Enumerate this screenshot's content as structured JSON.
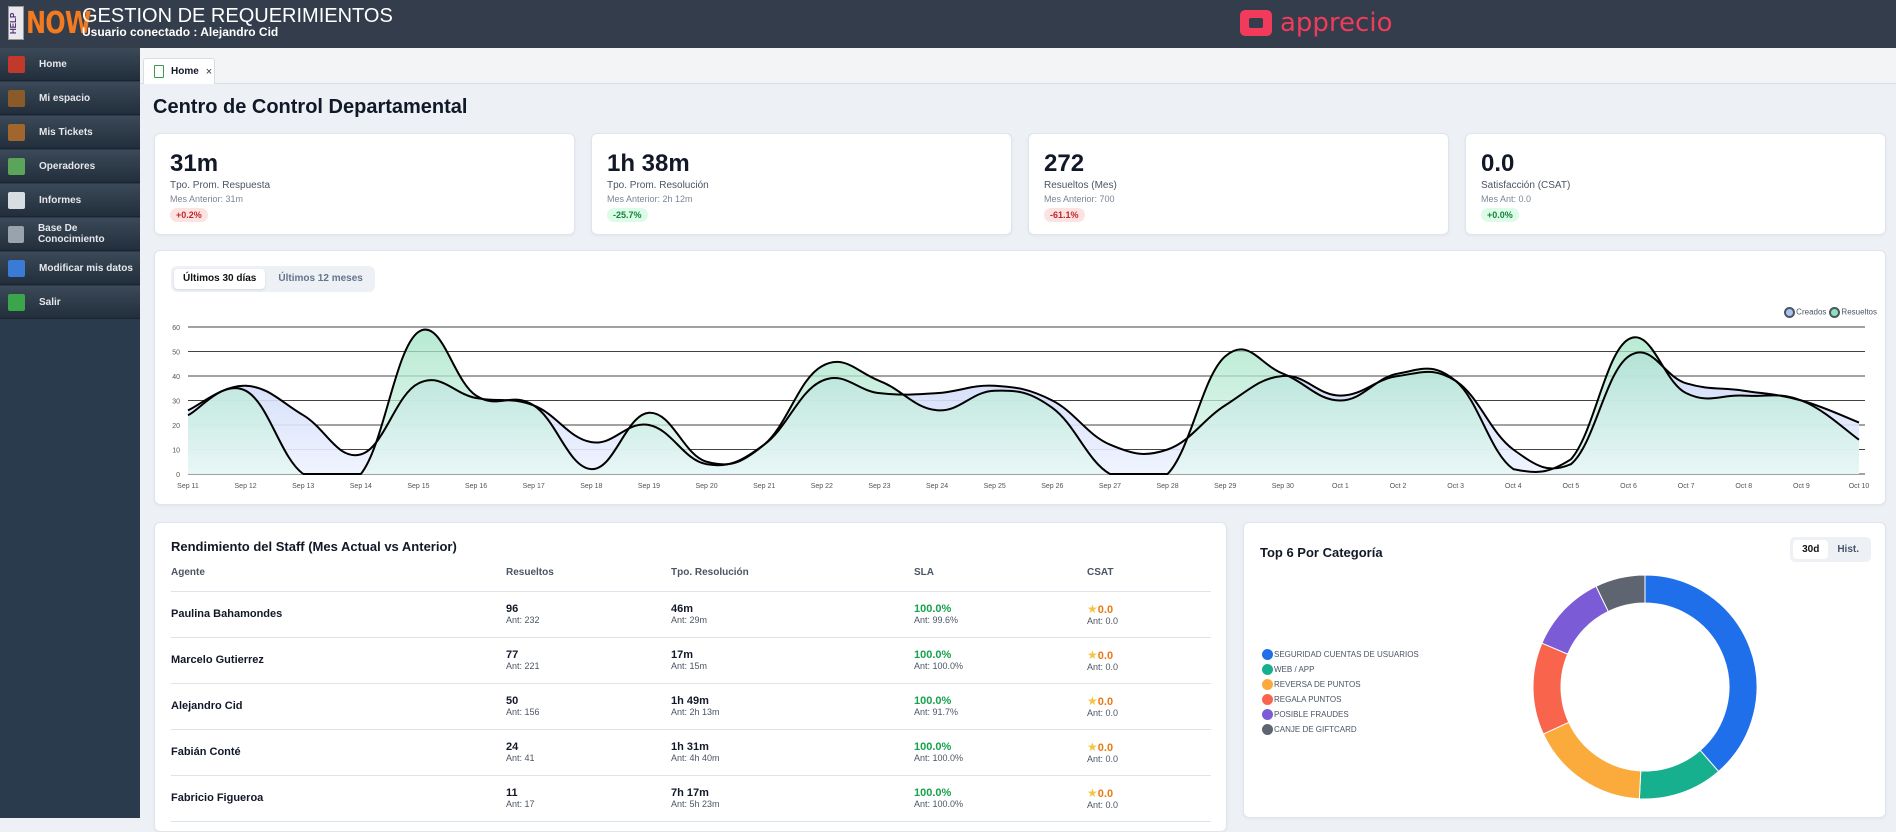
{
  "header": {
    "logo_text": "HELP NOW",
    "title": "GESTION DE REQUERIMIENTOS",
    "user": "Usuario conectado : Alejandro Cid",
    "brand": "apprecio",
    "brand_color": "#f23a5a"
  },
  "sidebar": {
    "items": [
      {
        "label": "Home",
        "icon": "home-icon",
        "color": "#c0392b"
      },
      {
        "label": "Mi espacio",
        "icon": "briefcase-icon",
        "color": "#8b5a2b"
      },
      {
        "label": "Mis Tickets",
        "icon": "book-icon",
        "color": "#a0662e"
      },
      {
        "label": "Operadores",
        "icon": "checklist-icon",
        "color": "#5aa55a"
      },
      {
        "label": "Informes",
        "icon": "documents-icon",
        "color": "#d8dde3"
      },
      {
        "label": "Base De Conocimiento",
        "icon": "open-book-icon",
        "color": "#9aa3ad"
      },
      {
        "label": "Modificar mis datos",
        "icon": "pen-icon",
        "color": "#3a7bd5"
      },
      {
        "label": "Salir",
        "icon": "exit-icon",
        "color": "#3aa54a"
      }
    ]
  },
  "tabs": [
    {
      "label": "Home",
      "close": "×"
    }
  ],
  "page_title": "Centro de Control Departamental",
  "kpis": [
    {
      "value": "31m",
      "label": "Tpo. Prom. Respuesta",
      "prev": "Mes Anterior: 31m",
      "delta": "+0.2%",
      "status": "bad"
    },
    {
      "value": "1h 38m",
      "label": "Tpo. Prom. Resolución",
      "prev": "Mes Anterior: 2h 12m",
      "delta": "-25.7%",
      "status": "good"
    },
    {
      "value": "272",
      "label": "Resueltos (Mes)",
      "prev": "Mes Anterior: 700",
      "delta": "-61.1%",
      "status": "bad"
    },
    {
      "value": "0.0",
      "label": "Satisfacción (CSAT)",
      "prev": "Mes Ant: 0.0",
      "delta": "+0.0%",
      "status": "good"
    }
  ],
  "trend": {
    "range_tabs": [
      "Últimos 30 días",
      "Últimos 12 meses"
    ],
    "active": 0
  },
  "chart_data": {
    "type": "area",
    "grid": true,
    "legend": "top-right",
    "ylim": [
      0,
      60
    ],
    "yticks": [
      0,
      10,
      20,
      30,
      40,
      50,
      60
    ],
    "categories": [
      "Sep 11",
      "Sep 12",
      "Sep 13",
      "Sep 14",
      "Sep 15",
      "Sep 16",
      "Sep 17",
      "Sep 18",
      "Sep 19",
      "Sep 20",
      "Sep 21",
      "Sep 22",
      "Sep 23",
      "Sep 24",
      "Sep 25",
      "Sep 26",
      "Sep 27",
      "Sep 28",
      "Sep 29",
      "Sep 30",
      "Oct 1",
      "Oct 2",
      "Oct 3",
      "Oct 4",
      "Oct 5",
      "Oct 6",
      "Oct 7",
      "Oct 8",
      "Oct 9",
      "Oct 10"
    ],
    "series": [
      {
        "name": "Creados",
        "color": "#a8c4f0",
        "values": [
          26,
          36,
          24,
          8,
          37,
          31,
          28,
          13,
          20,
          4,
          12,
          38,
          33,
          33,
          36,
          30,
          12,
          10,
          28,
          40,
          32,
          40,
          38,
          10,
          4,
          48,
          37,
          34,
          30,
          21
        ]
      },
      {
        "name": "Resueltos",
        "color": "#8ee0b8",
        "values": [
          24,
          34,
          0,
          0,
          58,
          32,
          28,
          2,
          25,
          5,
          12,
          44,
          38,
          26,
          34,
          27,
          0,
          0,
          48,
          41,
          30,
          41,
          38,
          2,
          6,
          55,
          33,
          32,
          30,
          14
        ]
      }
    ]
  },
  "staff": {
    "title": "Rendimiento del Staff (Mes Actual vs Anterior)",
    "columns": [
      "Agente",
      "Resueltos",
      "Tpo. Resolución",
      "SLA",
      "CSAT"
    ],
    "rows": [
      {
        "agent": "Paulina Bahamondes",
        "resueltos": "96",
        "resueltos_ant": "Ant: 232",
        "tiempo": "46m",
        "tiempo_ant": "Ant: 29m",
        "sla": "100.0%",
        "sla_ant": "Ant: 99.6%",
        "csat": "0.0",
        "csat_ant": "Ant: 0.0"
      },
      {
        "agent": "Marcelo Gutierrez",
        "resueltos": "77",
        "resueltos_ant": "Ant: 221",
        "tiempo": "17m",
        "tiempo_ant": "Ant: 15m",
        "sla": "100.0%",
        "sla_ant": "Ant: 100.0%",
        "csat": "0.0",
        "csat_ant": "Ant: 0.0"
      },
      {
        "agent": "Alejandro Cid",
        "resueltos": "50",
        "resueltos_ant": "Ant: 156",
        "tiempo": "1h 49m",
        "tiempo_ant": "Ant: 2h 13m",
        "sla": "100.0%",
        "sla_ant": "Ant: 91.7%",
        "csat": "0.0",
        "csat_ant": "Ant: 0.0"
      },
      {
        "agent": "Fabián Conté",
        "resueltos": "24",
        "resueltos_ant": "Ant: 41",
        "tiempo": "1h 31m",
        "tiempo_ant": "Ant: 4h 40m",
        "sla": "100.0%",
        "sla_ant": "Ant: 100.0%",
        "csat": "0.0",
        "csat_ant": "Ant: 0.0"
      },
      {
        "agent": "Fabricio Figueroa",
        "resueltos": "11",
        "resueltos_ant": "Ant: 17",
        "tiempo": "7h 17m",
        "tiempo_ant": "Ant: 5h 23m",
        "sla": "100.0%",
        "sla_ant": "Ant: 100.0%",
        "csat": "0.0",
        "csat_ant": "Ant: 0.0"
      }
    ]
  },
  "categories": {
    "title": "Top 6 Por Categoría",
    "toggle": [
      "30d",
      "Hist."
    ],
    "active": 0,
    "donut": {
      "type": "pie",
      "unit": "percent",
      "items": [
        {
          "label": "SEGURIDAD CUENTAS DE USUARIOS",
          "value": 38.6,
          "color": "#1f6feb"
        },
        {
          "label": "WEB / APP",
          "value": 12.2,
          "color": "#17b08f"
        },
        {
          "label": "REVERSA DE PUNTOS",
          "value": 17.3,
          "color": "#fbab3c"
        },
        {
          "label": "REGALA PUNTOS",
          "value": 13.3,
          "color": "#f9654c"
        },
        {
          "label": "POSIBLE FRAUDES",
          "value": 11.4,
          "color": "#7c5cd6"
        },
        {
          "label": "CANJE DE GIFTCARD",
          "value": 7.2,
          "color": "#5e6470"
        }
      ]
    }
  }
}
